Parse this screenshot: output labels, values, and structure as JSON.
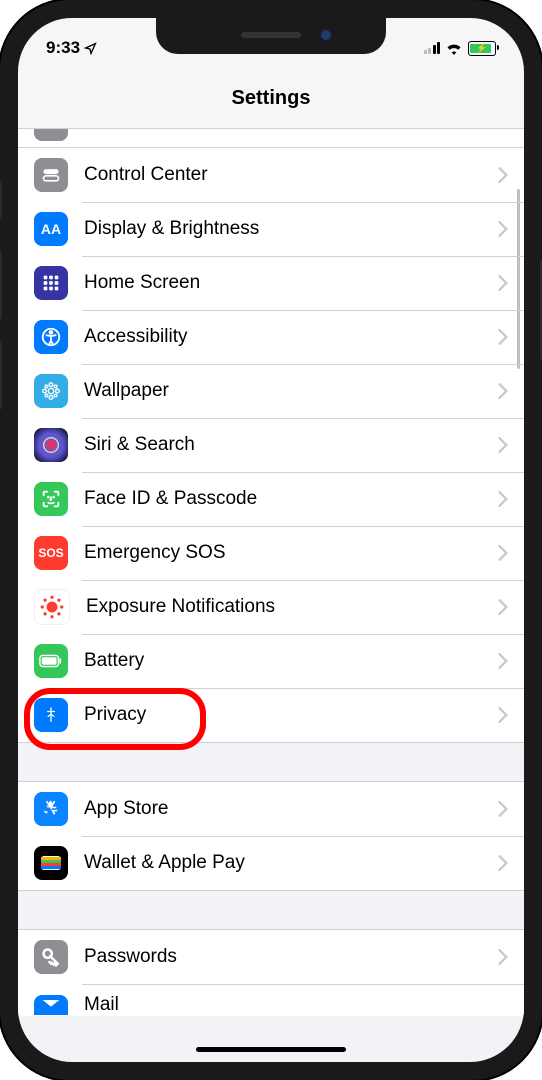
{
  "status": {
    "time": "9:33"
  },
  "header": {
    "title": "Settings"
  },
  "rows": {
    "control_center": "Control Center",
    "display": "Display & Brightness",
    "home_screen": "Home Screen",
    "accessibility": "Accessibility",
    "wallpaper": "Wallpaper",
    "siri": "Siri & Search",
    "faceid": "Face ID & Passcode",
    "sos": "Emergency SOS",
    "sos_icon": "SOS",
    "exposure": "Exposure Notifications",
    "battery": "Battery",
    "privacy": "Privacy",
    "app_store": "App Store",
    "wallet": "Wallet & Apple Pay",
    "passwords": "Passwords",
    "mail": "Mail"
  },
  "icons": {
    "aa": "AA"
  },
  "colors": {
    "blue": "#007aff",
    "gray": "#8e8e93",
    "indigo": "#5856d6",
    "cyan": "#32ade6",
    "green": "#34c759",
    "red": "#ff3b30",
    "orange": "#ff9500"
  }
}
